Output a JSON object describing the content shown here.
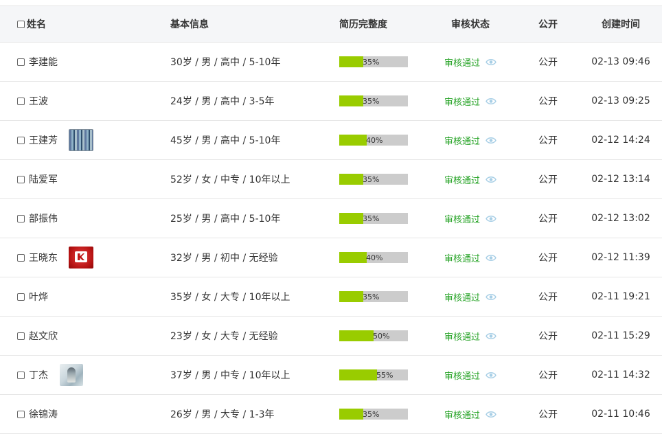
{
  "header": {
    "name": "姓名",
    "info": "基本信息",
    "progress": "简历完整度",
    "status": "审核状态",
    "public": "公开",
    "time": "创建时间"
  },
  "colors": {
    "progress_fill": "#99cc00",
    "progress_track": "#cccccc",
    "status_green": "#23a223",
    "eye_icon": "#a8cfe6"
  },
  "rows": [
    {
      "name": "李建能",
      "avatar": null,
      "info": "30岁 / 男 / 高中 / 5-10年",
      "progress": 35,
      "progress_label": "35%",
      "status": "审核通过",
      "public": "公开",
      "time": "02-13 09:46"
    },
    {
      "name": "王波",
      "avatar": null,
      "info": "24岁 / 男 / 高中 / 3-5年",
      "progress": 35,
      "progress_label": "35%",
      "status": "审核通过",
      "public": "公开",
      "time": "02-13 09:25"
    },
    {
      "name": "王建芳",
      "avatar": "striped-photo",
      "info": "45岁 / 男 / 高中 / 5-10年",
      "progress": 40,
      "progress_label": "40%",
      "status": "审核通过",
      "public": "公开",
      "time": "02-12 14:24"
    },
    {
      "name": "陆爱军",
      "avatar": null,
      "info": "52岁 / 女 / 中专 / 10年以上",
      "progress": 35,
      "progress_label": "35%",
      "status": "审核通过",
      "public": "公开",
      "time": "02-12 13:14"
    },
    {
      "name": "部振伟",
      "avatar": null,
      "info": "25岁 / 男 / 高中 / 5-10年",
      "progress": 35,
      "progress_label": "35%",
      "status": "审核通过",
      "public": "公开",
      "time": "02-12 13:02"
    },
    {
      "name": "王晓东",
      "avatar": "red-logo",
      "info": "32岁 / 男 / 初中 / 无经验",
      "progress": 40,
      "progress_label": "40%",
      "status": "审核通过",
      "public": "公开",
      "time": "02-12 11:39"
    },
    {
      "name": "叶烨",
      "avatar": null,
      "info": "35岁 / 女 / 大专 / 10年以上",
      "progress": 35,
      "progress_label": "35%",
      "status": "审核通过",
      "public": "公开",
      "time": "02-11 19:21"
    },
    {
      "name": "赵文欣",
      "avatar": null,
      "info": "23岁 / 女 / 大专 / 无经验",
      "progress": 50,
      "progress_label": "50%",
      "status": "审核通过",
      "public": "公开",
      "time": "02-11 15:29"
    },
    {
      "name": "丁杰",
      "avatar": "person-photo",
      "info": "37岁 / 男 / 中专 / 10年以上",
      "progress": 55,
      "progress_label": "55%",
      "status": "审核通过",
      "public": "公开",
      "time": "02-11 14:32"
    },
    {
      "name": "徐锦涛",
      "avatar": null,
      "info": "26岁 / 男 / 大专 / 1-3年",
      "progress": 35,
      "progress_label": "35%",
      "status": "审核通过",
      "public": "公开",
      "time": "02-11 10:46"
    }
  ]
}
